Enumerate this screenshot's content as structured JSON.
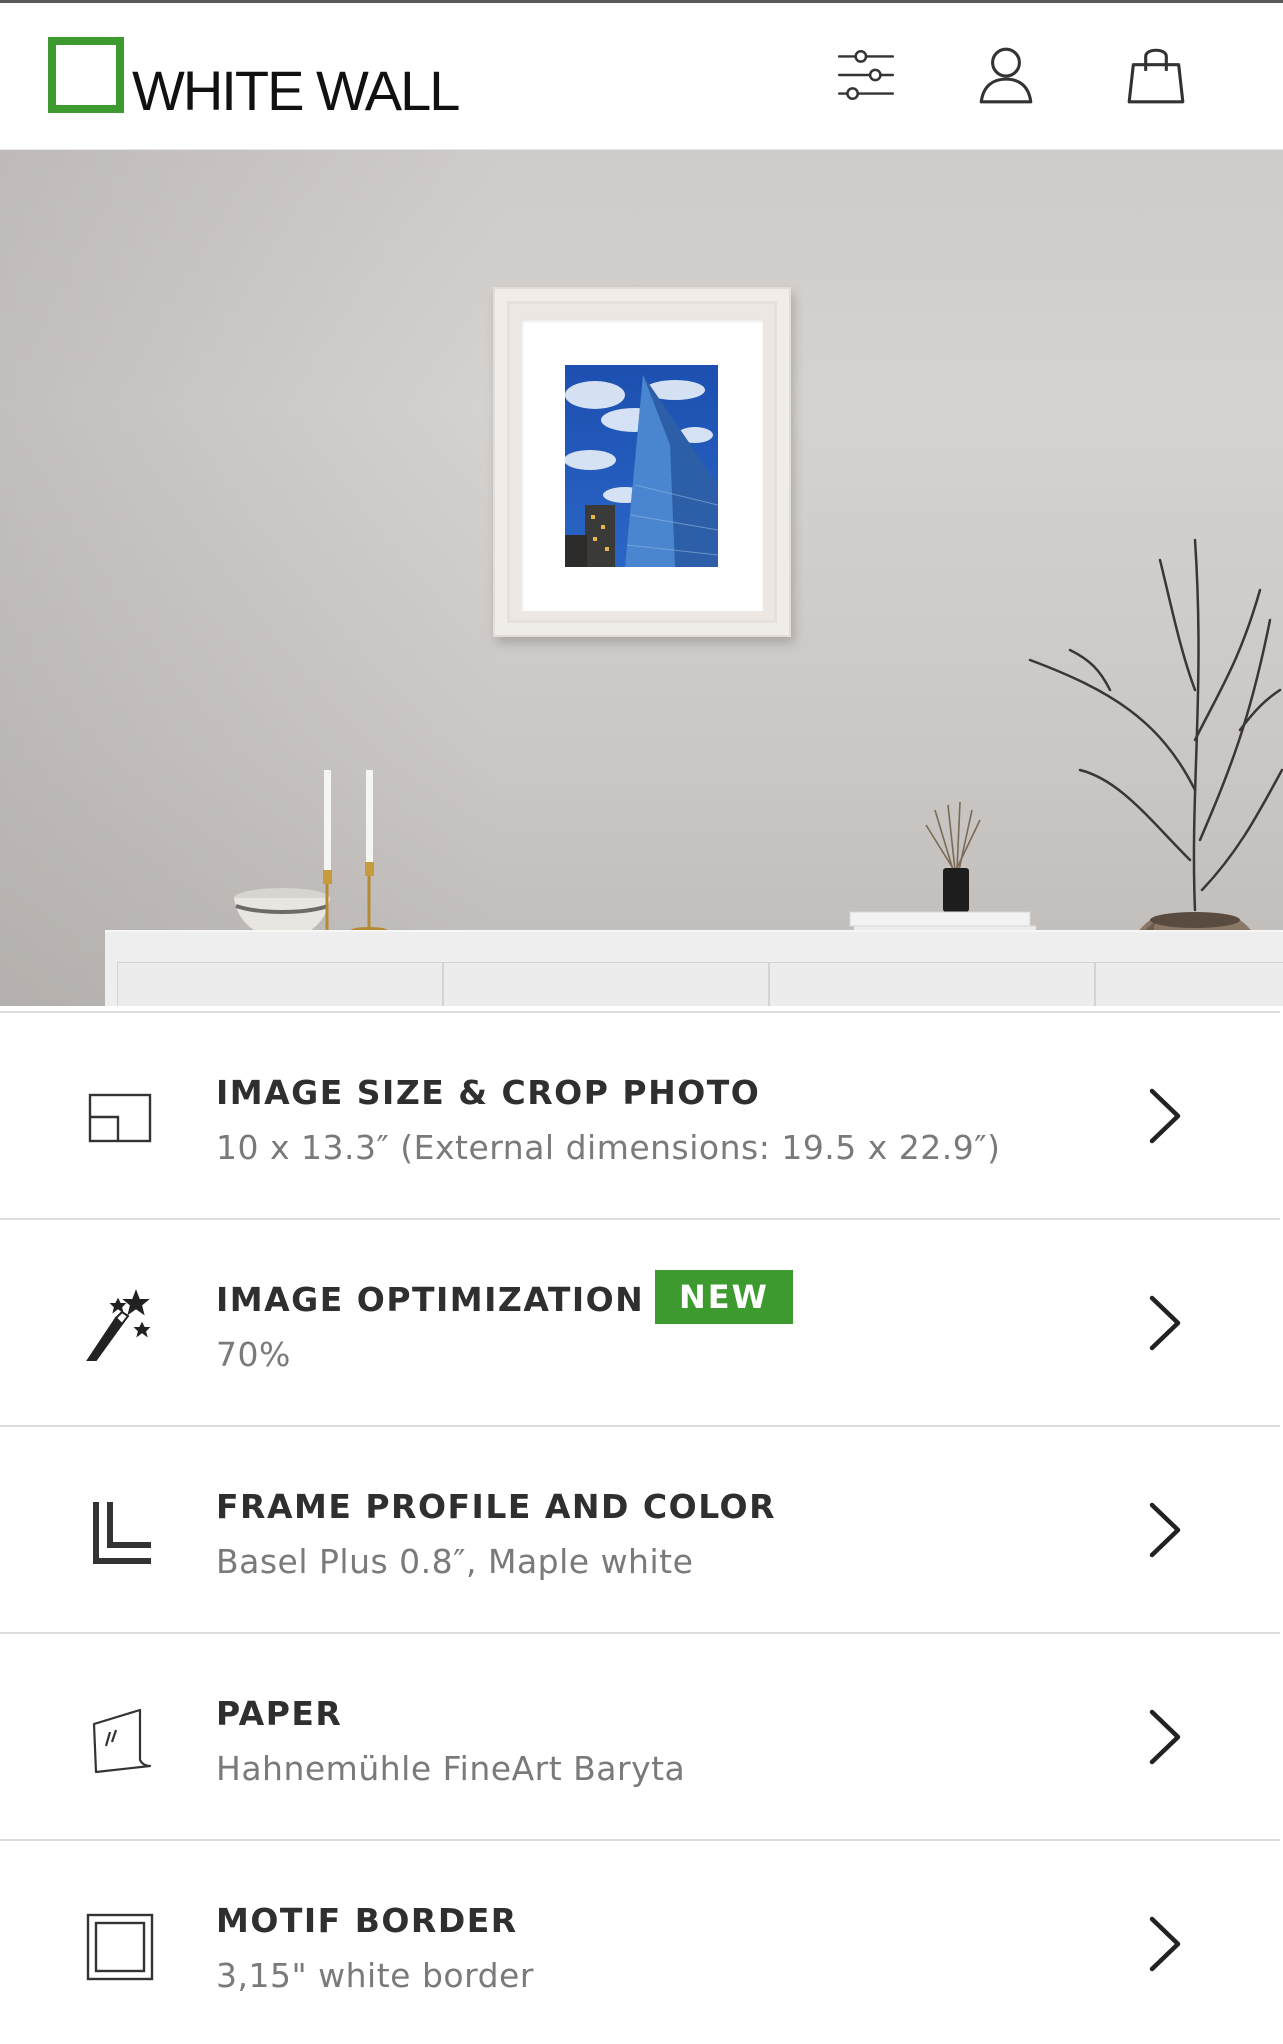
{
  "header": {
    "logo_text": "WHITE WALL",
    "icons": [
      "filter-sliders-icon",
      "user-account-icon",
      "shopping-bag-icon"
    ]
  },
  "preview": {
    "description_icons": [
      "framed-photo",
      "sideboard",
      "vase-with-branches",
      "candle-holders",
      "reed-diffuser"
    ]
  },
  "options": [
    {
      "id": "size",
      "icon": "crop-size-icon",
      "title": "IMAGE SIZE & CROP PHOTO",
      "subtitle": "10 x 13.3″ (External dimensions: 19.5 x 22.9″)"
    },
    {
      "id": "optimization",
      "icon": "magic-wand-icon",
      "title": "IMAGE OPTIMIZATION",
      "badge": "NEW",
      "subtitle": "70%"
    },
    {
      "id": "frame",
      "icon": "frame-profile-icon",
      "title": "FRAME PROFILE AND COLOR",
      "subtitle": "Basel Plus 0.8″, Maple white"
    },
    {
      "id": "paper",
      "icon": "paper-sheet-icon",
      "title": "PAPER",
      "subtitle": "Hahnemühle FineArt Baryta"
    },
    {
      "id": "border",
      "icon": "motif-border-icon",
      "title": "MOTIF BORDER",
      "subtitle": "3,15\" white border"
    }
  ],
  "colors": {
    "brand_green": "#3c9a2e",
    "title_text": "#2f2f2f",
    "subtitle_text": "#7a7a7a",
    "divider": "#dcdcdc"
  }
}
